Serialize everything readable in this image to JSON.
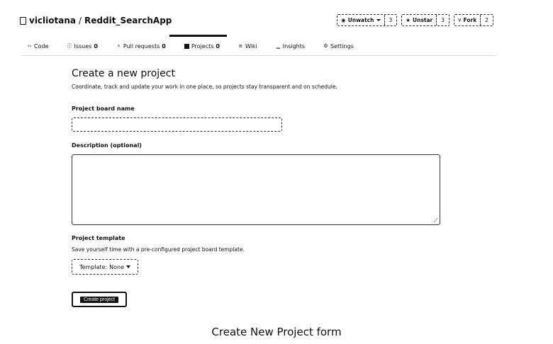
{
  "repo": {
    "owner": "vicliotana",
    "separator": "/",
    "name": "Reddit_SearchApp"
  },
  "actions": {
    "watch": {
      "label": "Unwatch",
      "count": "3"
    },
    "star": {
      "label": "Unstar",
      "count": "3"
    },
    "fork": {
      "label": "Fork",
      "count": "2"
    }
  },
  "tabs": [
    {
      "label": "Code",
      "count": ""
    },
    {
      "label": "Issues",
      "count": "0"
    },
    {
      "label": "Pull requests",
      "count": "0"
    },
    {
      "label": "Projects",
      "count": "0"
    },
    {
      "label": "Wiki",
      "count": ""
    },
    {
      "label": "Insights",
      "count": ""
    },
    {
      "label": "Settings",
      "count": ""
    }
  ],
  "form": {
    "title": "Create a new project",
    "subtitle": "Coordinate, track and update your work in one place, so projects stay transparent and on schedule.",
    "name_label": "Project board name",
    "name_value": "",
    "description_label": "Description (optional)",
    "description_value": "",
    "template_label": "Project template",
    "template_help": "Save yourself time with a pre-configured project board template.",
    "template_prefix": "Template:",
    "template_value": "None",
    "create_button": "Create project"
  },
  "caption": "Create New Project form"
}
